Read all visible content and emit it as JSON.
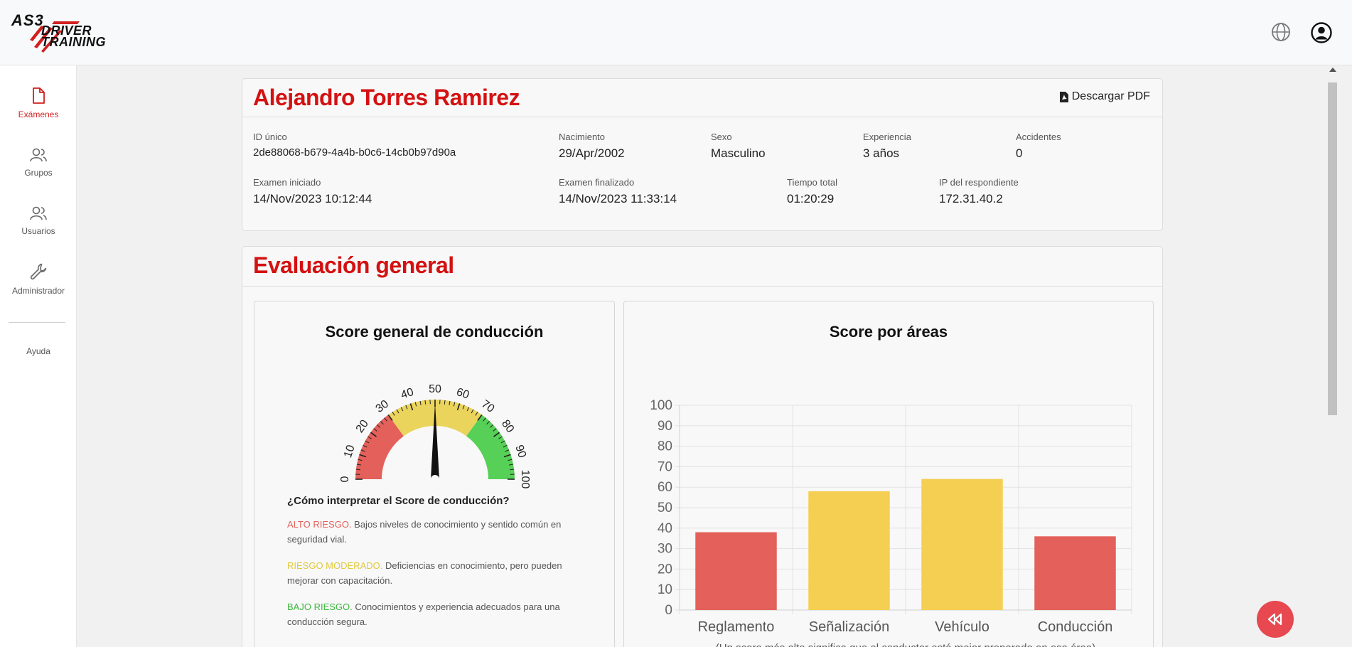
{
  "brand": {
    "line1": "AS3",
    "line2": "DRIVER",
    "line3": "TRAINING",
    "accent": "#d41111"
  },
  "topbar": {
    "icons": [
      "globe-icon",
      "user-circle-icon"
    ]
  },
  "sidebar": {
    "items": [
      {
        "label": "Exámenes",
        "icon": "file-icon",
        "active": true
      },
      {
        "label": "Grupos",
        "icon": "users-icon"
      },
      {
        "label": "Usuarios",
        "icon": "users-icon"
      },
      {
        "label": "Administrador",
        "icon": "wrench-icon"
      }
    ],
    "help_label": "Ayuda"
  },
  "profile": {
    "name": "Alejandro Torres Ramirez",
    "pdf_label": "Descargar PDF",
    "fields": {
      "id": {
        "label": "ID único",
        "value": "2de88068-b679-4a4b-b0c6-14cb0b97d90a"
      },
      "birth": {
        "label": "Nacimiento",
        "value": "29/Apr/2002"
      },
      "sex": {
        "label": "Sexo",
        "value": "Masculino"
      },
      "experience": {
        "label": "Experiencia",
        "value": "3 años"
      },
      "accidents": {
        "label": "Accidentes",
        "value": "0"
      },
      "started": {
        "label": "Examen iniciado",
        "value": "14/Nov/2023 10:12:44"
      },
      "finished": {
        "label": "Examen finalizado",
        "value": "14/Nov/2023 11:33:14"
      },
      "total": {
        "label": "Tiempo total",
        "value": "01:20:29"
      },
      "ip": {
        "label": "IP del respondiente",
        "value": "172.31.40.2"
      }
    }
  },
  "evaluation": {
    "title": "Evaluación general",
    "gauge_title": "Score general de conducción",
    "gauge": {
      "value": 50,
      "ticks": [
        "0",
        "10",
        "20",
        "30",
        "40",
        "50",
        "60",
        "70",
        "80",
        "90",
        "100"
      ],
      "bands": [
        {
          "from": 0,
          "to": 30,
          "color": "#e4605a"
        },
        {
          "from": 30,
          "to": 70,
          "color": "#ebd45c"
        },
        {
          "from": 70,
          "to": 100,
          "color": "#56d056"
        }
      ]
    },
    "interp": {
      "heading": "¿Cómo interpretar el Score de conducción?",
      "high_label": "ALTO RIESGO.",
      "high_text": " Bajos niveles de conocimiento y sentido común en seguridad vial.",
      "mid_label": "RIESGO MODERADO.",
      "mid_text": " Deficiencias en conocimiento, pero pueden mejorar con capacitación.",
      "low_label": "BAJO RIESGO.",
      "low_text": " Conocimientos y experiencia adecuados para una conducción segura.",
      "colors": {
        "high": "#e4605a",
        "mid": "#e0c93e",
        "low": "#3fb83f"
      }
    },
    "areas_title": "Score por áreas"
  },
  "chart_data": {
    "type": "bar",
    "categories": [
      "Reglamento",
      "Señalización",
      "Vehículo",
      "Conducción"
    ],
    "values": [
      38,
      58,
      64,
      36
    ],
    "colors": [
      "#e4605a",
      "#f5cf52",
      "#f5cf52",
      "#e4605a"
    ],
    "ylim": [
      0,
      100
    ],
    "yticks": [
      0,
      10,
      20,
      30,
      40,
      50,
      60,
      70,
      80,
      90,
      100
    ],
    "grid": true,
    "note": "(Un score más alto significa que el conductor está mejor preparado en esa área)"
  }
}
